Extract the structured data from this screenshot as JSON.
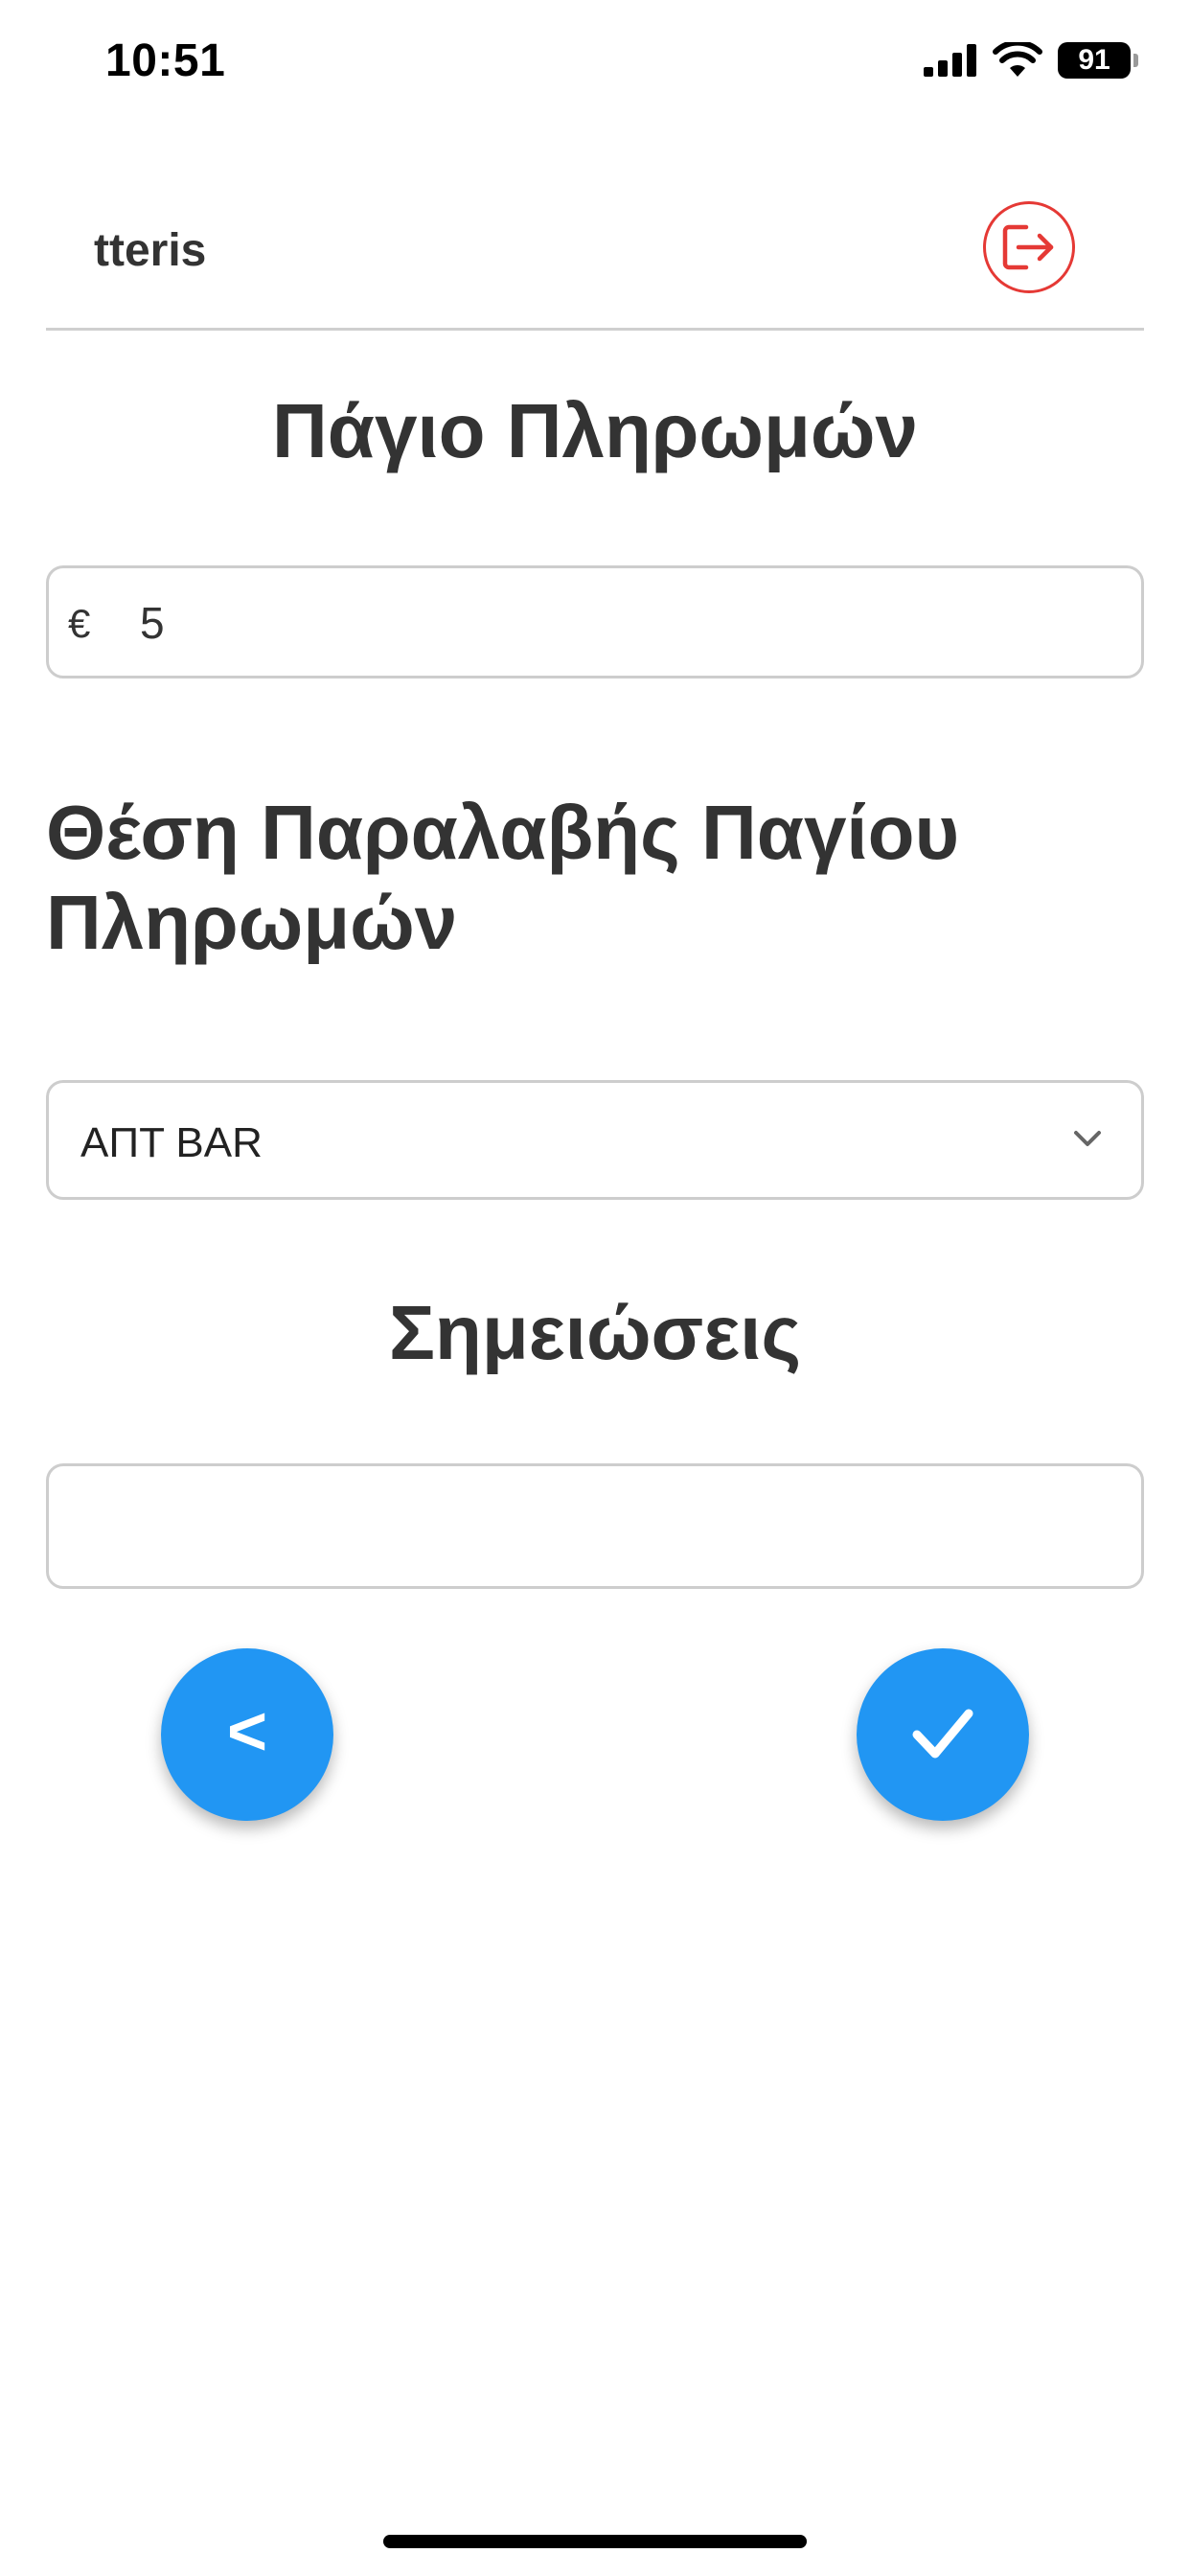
{
  "status_bar": {
    "time": "10:51",
    "battery": "91",
    "icons": [
      "cellular-signal-icon",
      "wifi-icon",
      "battery-icon"
    ]
  },
  "header": {
    "user": "tteris",
    "logout_icon": "logout-icon",
    "logout_color": "#e53935"
  },
  "amount_section": {
    "title": "Πάγιο Πληρωμών",
    "currency": "€",
    "value": "5"
  },
  "location_section": {
    "title": "Θέση Παραλαβής Παγίου Πληρωμών",
    "selected": "ΑΠΤ BAR",
    "chevron_icon": "chevron-down-icon"
  },
  "notes_section": {
    "title": "Σημειώσεις",
    "value": ""
  },
  "actions": {
    "back_label": "<",
    "confirm_icon": "checkmark-icon",
    "button_color": "#2196f3"
  }
}
